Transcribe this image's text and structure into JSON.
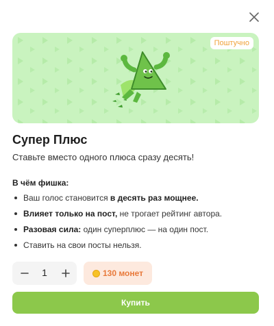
{
  "modal": {
    "close_icon": "close-icon",
    "badge": "Поштучно",
    "title": "Супер Плюс",
    "subtitle": "Ставьте вместо одного плюса сразу десять!",
    "features_heading": "В чём фишка:",
    "features": [
      {
        "pre": "Ваш голос становится ",
        "bold": "в десять раз мощнее.",
        "post": ""
      },
      {
        "pre": "",
        "bold": "Влияет только на пост,",
        "post": " не трогает рейтинг автора."
      },
      {
        "pre": "",
        "bold": "Разовая сила:",
        "post": " один суперплюс — на один пост."
      },
      {
        "pre": "Ставить на свои посты нельзя.",
        "bold": "",
        "post": ""
      }
    ],
    "quantity": "1",
    "price": "130 монет",
    "buy_label": "Купить"
  },
  "colors": {
    "banner_bg": "#c9f3bf",
    "accent_green": "#8cc84b",
    "price_bg": "#fde9de",
    "price_text": "#e8793a",
    "badge_text": "#f0a23a"
  }
}
